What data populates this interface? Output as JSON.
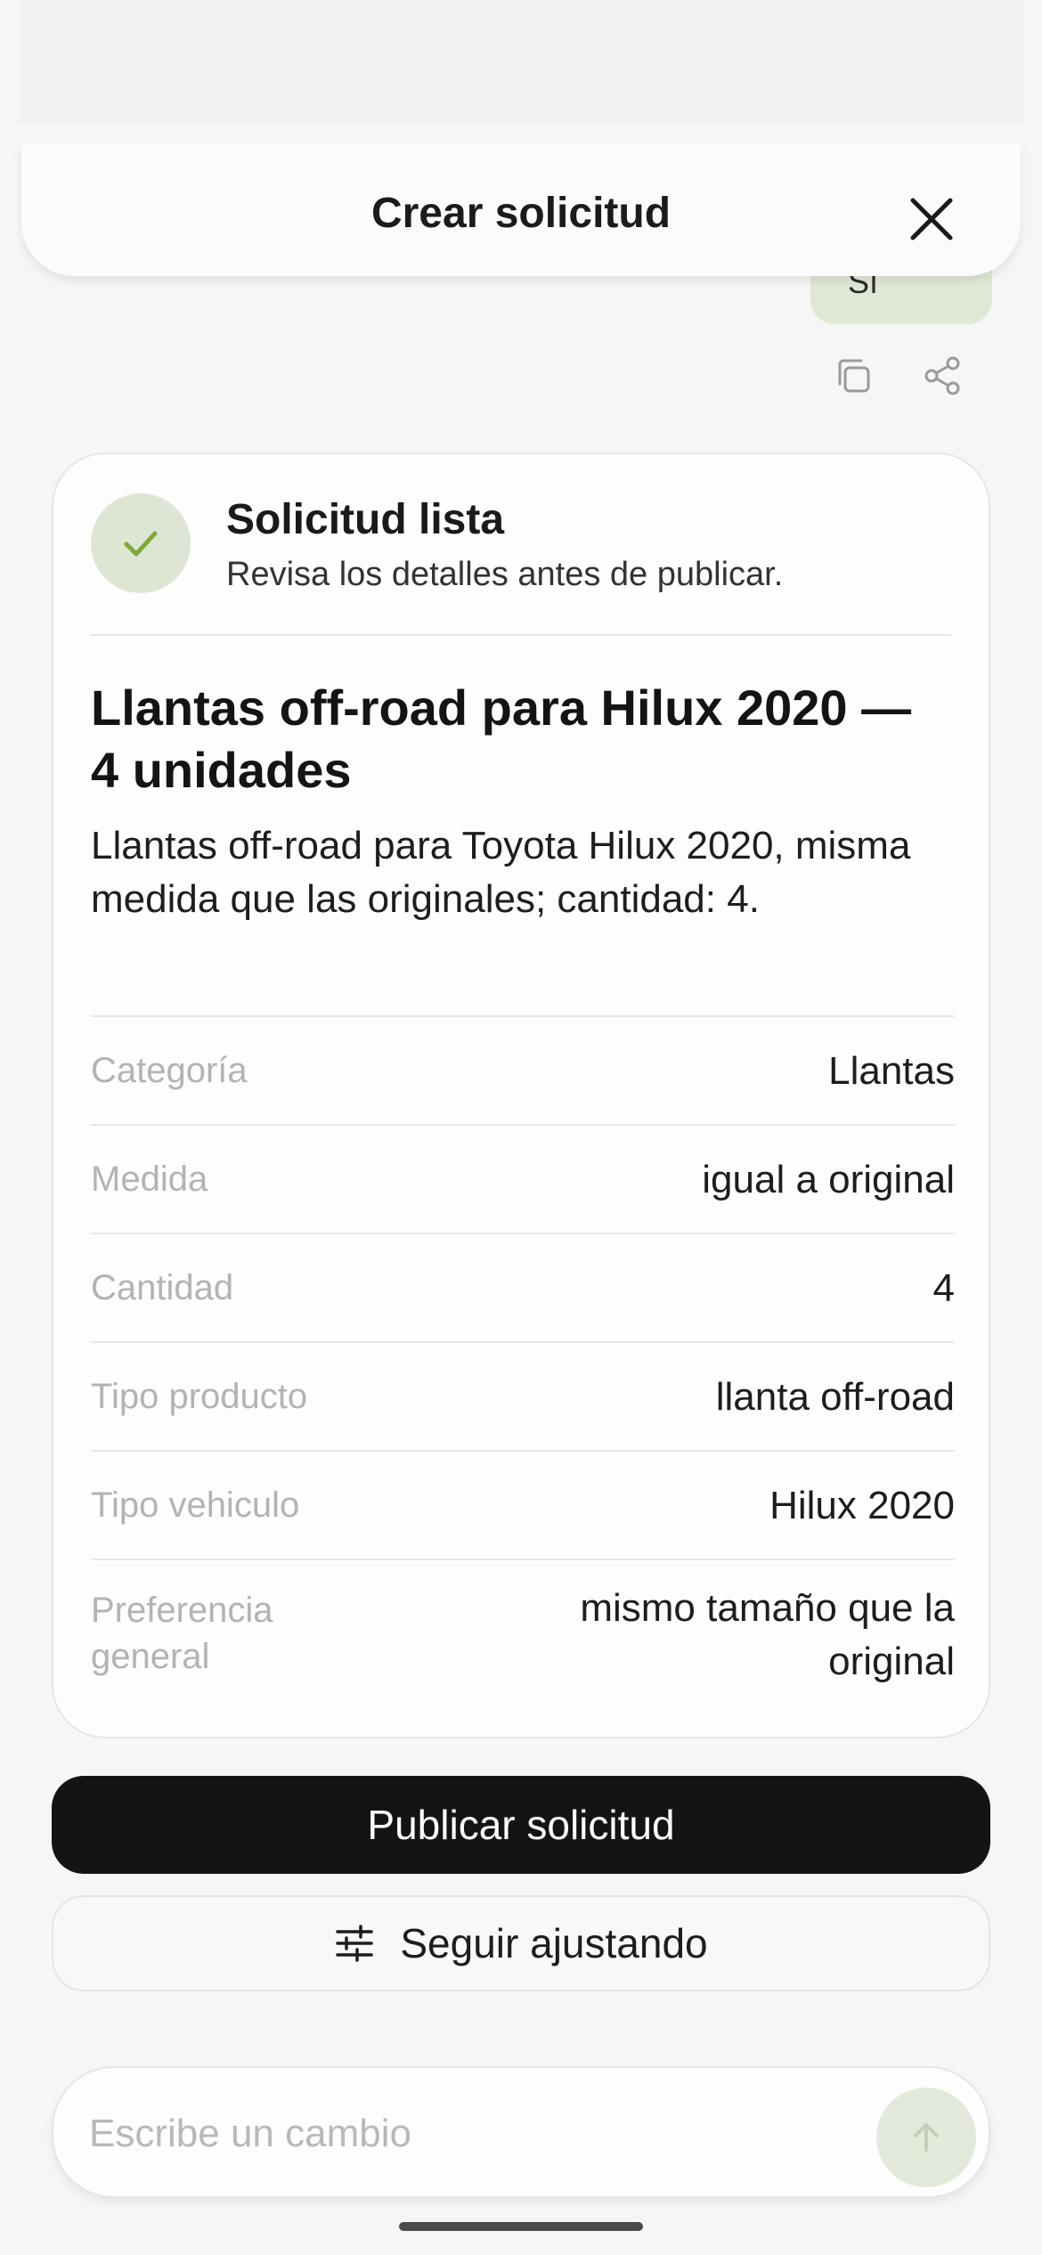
{
  "header": {
    "title": "Crear solicitud",
    "close_icon": "close-icon"
  },
  "chat": {
    "user_message": "Sí",
    "actions": {
      "copy_icon": "copy-icon",
      "share_icon": "share-icon"
    }
  },
  "summary": {
    "status_title": "Solicitud lista",
    "status_subtitle": "Revisa los detalles antes de publicar.",
    "title": "Llantas off-road para Hilux 2020 — 4 unidades",
    "description": "Llantas off-road para Toyota Hilux 2020, misma medida que las originales; cantidad: 4.",
    "details": [
      {
        "label": "Categoría",
        "value": "Llantas"
      },
      {
        "label": "Medida",
        "value": "igual a original"
      },
      {
        "label": "Cantidad",
        "value": "4"
      },
      {
        "label": "Tipo producto",
        "value": "llanta off-road"
      },
      {
        "label": "Tipo vehiculo",
        "value": "Hilux 2020"
      },
      {
        "label": "Preferencia general",
        "value": "mismo tamaño que la original"
      }
    ]
  },
  "actions": {
    "publish_label": "Publicar solicitud",
    "adjust_label": "Seguir ajustando",
    "adjust_icon": "sliders-icon"
  },
  "composer": {
    "placeholder": "Escribe un cambio",
    "value": "",
    "send_icon": "arrow-up-icon"
  },
  "colors": {
    "accent_green": "#7fa83a",
    "soft_green": "#dde6d3",
    "primary_button": "#141414"
  }
}
